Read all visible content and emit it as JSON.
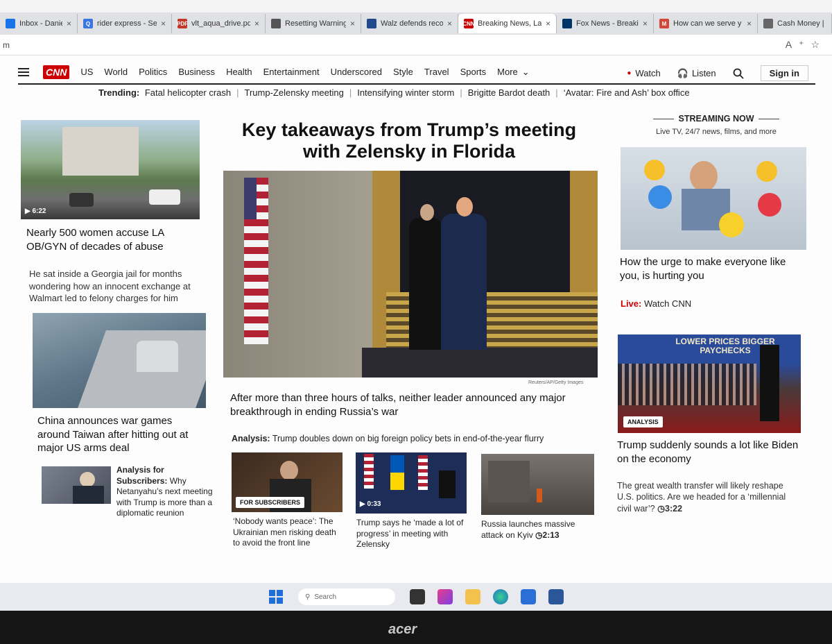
{
  "tabs": [
    {
      "title": "Inbox - Daniel Popo",
      "favicon_color": "#1a73e8",
      "favicon_text": ""
    },
    {
      "title": "rider express - Sear",
      "favicon_color": "#3a76e0",
      "favicon_text": "Q"
    },
    {
      "title": "vlt_aqua_drive.pdf",
      "favicon_color": "#c0392b",
      "favicon_text": "PDF"
    },
    {
      "title": "Resetting Warning I",
      "favicon_color": "#555555",
      "favicon_text": ""
    },
    {
      "title": "Walz defends recor",
      "favicon_color": "#1f4a8c",
      "favicon_text": ""
    },
    {
      "title": "Breaking News, Late",
      "favicon_color": "#cc0000",
      "favicon_text": "CNN"
    },
    {
      "title": "Fox News - Breakin",
      "favicon_color": "#003366",
      "favicon_text": ""
    },
    {
      "title": "How can we serve y",
      "favicon_color": "#d44638",
      "favicon_text": "M"
    },
    {
      "title": "Cash Money | Pay",
      "favicon_color": "#666666",
      "favicon_text": ""
    }
  ],
  "address": {
    "left_text": "m"
  },
  "nav": {
    "logo": "CNN",
    "items": [
      "US",
      "World",
      "Politics",
      "Business",
      "Health",
      "Entertainment",
      "Underscored",
      "Style",
      "Travel",
      "Sports",
      "More"
    ],
    "watch": "Watch",
    "listen": "Listen",
    "signin": "Sign in"
  },
  "trending": {
    "label": "Trending:",
    "items": [
      "Fatal helicopter crash",
      "Trump-Zelensky meeting",
      "Intensifying winter storm",
      "Brigitte Bardot death",
      "‘Avatar: Fire and Ash’ box office"
    ]
  },
  "left": {
    "story1": {
      "duration": "6:22",
      "headline": "Nearly 500 women accuse LA OB/GYN of decades of abuse"
    },
    "story2": {
      "headline": "He sat inside a Georgia jail for months wondering how an innocent exchange at Walmart led to felony charges for him"
    },
    "story3": {
      "headline": "China announces war games around Taiwan after hitting out at major US arms deal"
    },
    "story4": {
      "label": "Analysis for Subscribers:",
      "text": " Why Netanyahu’s next meeting with Trump is more than a diplomatic reunion"
    }
  },
  "center": {
    "headline": "Key takeaways from Trump’s meeting with Zelensky in Florida",
    "credit": "Reuters/AP/Getty Images",
    "summary": "After more than three hours of talks, neither leader announced any major breakthrough in ending Russia’s war",
    "analysis_label": "Analysis:",
    "analysis_text": " Trump doubles down on big foreign policy bets in end-of-the-year flurry",
    "cards": [
      {
        "badge": "FOR SUBSCRIBERS",
        "duration": "",
        "caption": "‘Nobody wants peace’: The Ukrainian men risking death to avoid the front line"
      },
      {
        "badge": "",
        "duration": "0:33",
        "caption": "Trump says he ‘made a lot of progress’ in meeting with Zelensky"
      },
      {
        "badge": "",
        "duration": "2:13",
        "caption": "Russia launches massive attack on Kyiv"
      }
    ]
  },
  "right": {
    "streaming_title": "STREAMING NOW",
    "streaming_sub": "Live TV, 24/7 news, films, and more",
    "story1": {
      "headline": "How the urge to make everyone like you, is hurting you"
    },
    "live_label": "Live:",
    "live_text": " Watch CNN",
    "story2": {
      "badge": "ANALYSIS",
      "image_sign": "LOWER PRICES BIGGER PAYCHECKS",
      "headline": "Trump suddenly sounds a lot like Biden on the economy"
    },
    "story3": {
      "text": "The great wealth transfer will likely reshape U.S. politics. Are we headed for a ‘millennial civil war’?",
      "duration": "3:22"
    }
  },
  "taskbar": {
    "search": "Search"
  },
  "monitor": {
    "brand": "acer"
  }
}
